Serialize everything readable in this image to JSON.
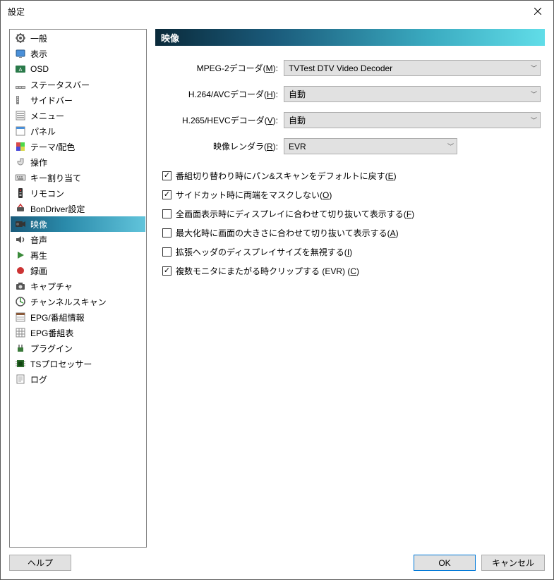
{
  "window": {
    "title": "設定"
  },
  "sidebar": {
    "items": [
      {
        "label": "一般"
      },
      {
        "label": "表示"
      },
      {
        "label": "OSD"
      },
      {
        "label": "ステータスバー"
      },
      {
        "label": "サイドバー"
      },
      {
        "label": "メニュー"
      },
      {
        "label": "パネル"
      },
      {
        "label": "テーマ/配色"
      },
      {
        "label": "操作"
      },
      {
        "label": "キー割り当て"
      },
      {
        "label": "リモコン"
      },
      {
        "label": "BonDriver設定"
      },
      {
        "label": "映像"
      },
      {
        "label": "音声"
      },
      {
        "label": "再生"
      },
      {
        "label": "録画"
      },
      {
        "label": "キャプチャ"
      },
      {
        "label": "チャンネルスキャン"
      },
      {
        "label": "EPG/番組情報"
      },
      {
        "label": "EPG番組表"
      },
      {
        "label": "プラグイン"
      },
      {
        "label": "TSプロセッサー"
      },
      {
        "label": "ログ"
      }
    ],
    "selected_index": 12
  },
  "panel": {
    "heading": "映像",
    "decoders": {
      "mpeg2": {
        "label_pre": "MPEG-2デコーダ(",
        "key": "M",
        "label_post": "):",
        "value": "TVTest DTV Video Decoder"
      },
      "h264": {
        "label_pre": "H.264/AVCデコーダ(",
        "key": "H",
        "label_post": "):",
        "value": "自動"
      },
      "h265": {
        "label_pre": "H.265/HEVCデコーダ(",
        "key": "V",
        "label_post": "):",
        "value": "自動"
      },
      "renderer": {
        "label_pre": "映像レンダラ(",
        "key": "R",
        "label_post": "):",
        "value": "EVR"
      }
    },
    "checks": [
      {
        "checked": true,
        "pre": "番組切り替わり時にパン&スキャンをデフォルトに戻す(",
        "key": "E",
        "post": ")"
      },
      {
        "checked": true,
        "pre": "サイドカット時に両端をマスクしない(",
        "key": "O",
        "post": ")"
      },
      {
        "checked": false,
        "pre": "全画面表示時にディスプレイに合わせて切り抜いて表示する(",
        "key": "F",
        "post": ")"
      },
      {
        "checked": false,
        "pre": "最大化時に画面の大きさに合わせて切り抜いて表示する(",
        "key": "A",
        "post": ")"
      },
      {
        "checked": false,
        "pre": "拡張ヘッダのディスプレイサイズを無視する(",
        "key": "I",
        "post": ")"
      },
      {
        "checked": true,
        "pre": "複数モニタにまたがる時クリップする (EVR) (",
        "key": "C",
        "post": ")"
      }
    ]
  },
  "footer": {
    "help": "ヘルプ",
    "ok": "OK",
    "cancel": "キャンセル"
  },
  "checkmark": "✓"
}
